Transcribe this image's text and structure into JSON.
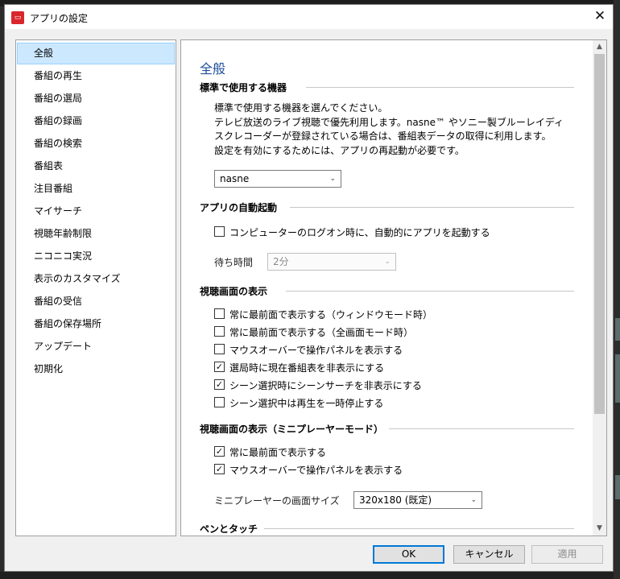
{
  "window": {
    "title": "アプリの設定",
    "close_glyph": "✕"
  },
  "sidebar": {
    "items": [
      {
        "label": "全般"
      },
      {
        "label": "番組の再生"
      },
      {
        "label": "番組の選局"
      },
      {
        "label": "番組の録画"
      },
      {
        "label": "番組の検索"
      },
      {
        "label": "番組表"
      },
      {
        "label": "注目番組"
      },
      {
        "label": "マイサーチ"
      },
      {
        "label": "視聴年齢制限"
      },
      {
        "label": "ニコニコ実況"
      },
      {
        "label": "表示のカスタマイズ"
      },
      {
        "label": "番組の受信"
      },
      {
        "label": "番組の保存場所"
      },
      {
        "label": "アップデート"
      },
      {
        "label": "初期化"
      }
    ],
    "selected_index": 0
  },
  "main": {
    "section_title": "全般",
    "device_group": {
      "heading": "標準で使用する機器",
      "desc": [
        "標準で使用する機器を選んでください。",
        "テレビ放送のライブ視聴で優先利用します。nasne™ やソニー製ブルーレイディ",
        "スクレコーダーが登録されている場合は、番組表データの取得に利用します。",
        "設定を有効にするためには、アプリの再起動が必要です。"
      ],
      "device_select": "nasne"
    },
    "autostart_group": {
      "heading": "アプリの自動起動",
      "autostart_label": "コンピューターのログオン時に、自動的にアプリを起動する",
      "autostart_checked": false,
      "wait_label": "待ち時間",
      "wait_value": "2分"
    },
    "view_group": {
      "heading": "視聴画面の表示",
      "options": [
        {
          "label": "常に最前面で表示する（ウィンドウモード時）",
          "checked": false
        },
        {
          "label": "常に最前面で表示する（全画面モード時）",
          "checked": false
        },
        {
          "label": "マウスオーバーで操作パネルを表示する",
          "checked": false
        },
        {
          "label": "選局時に現在番組表を非表示にする",
          "checked": true
        },
        {
          "label": "シーン選択時にシーンサーチを非表示にする",
          "checked": true
        },
        {
          "label": "シーン選択中は再生を一時停止する",
          "checked": false
        }
      ]
    },
    "mini_group": {
      "heading": "視聴画面の表示（ミニプレーヤーモード）",
      "options": [
        {
          "label": "常に最前面で表示する",
          "checked": true
        },
        {
          "label": "マウスオーバーで操作パネルを表示する",
          "checked": true
        }
      ],
      "size_label": "ミニプレーヤーの画面サイズ",
      "size_value": "320x180 (既定)"
    },
    "pen_group": {
      "heading": "ペンとタッチ"
    }
  },
  "footer": {
    "ok": "OK",
    "cancel": "キャンセル",
    "apply": "適用"
  },
  "icons": {
    "check": "✓",
    "chevron": "⌄",
    "scroll_up": "▲",
    "scroll_down": "▼"
  },
  "colors": {
    "accent": "#0078d7",
    "section_title": "#1f4e9a",
    "selection_bg": "#cce8ff"
  }
}
